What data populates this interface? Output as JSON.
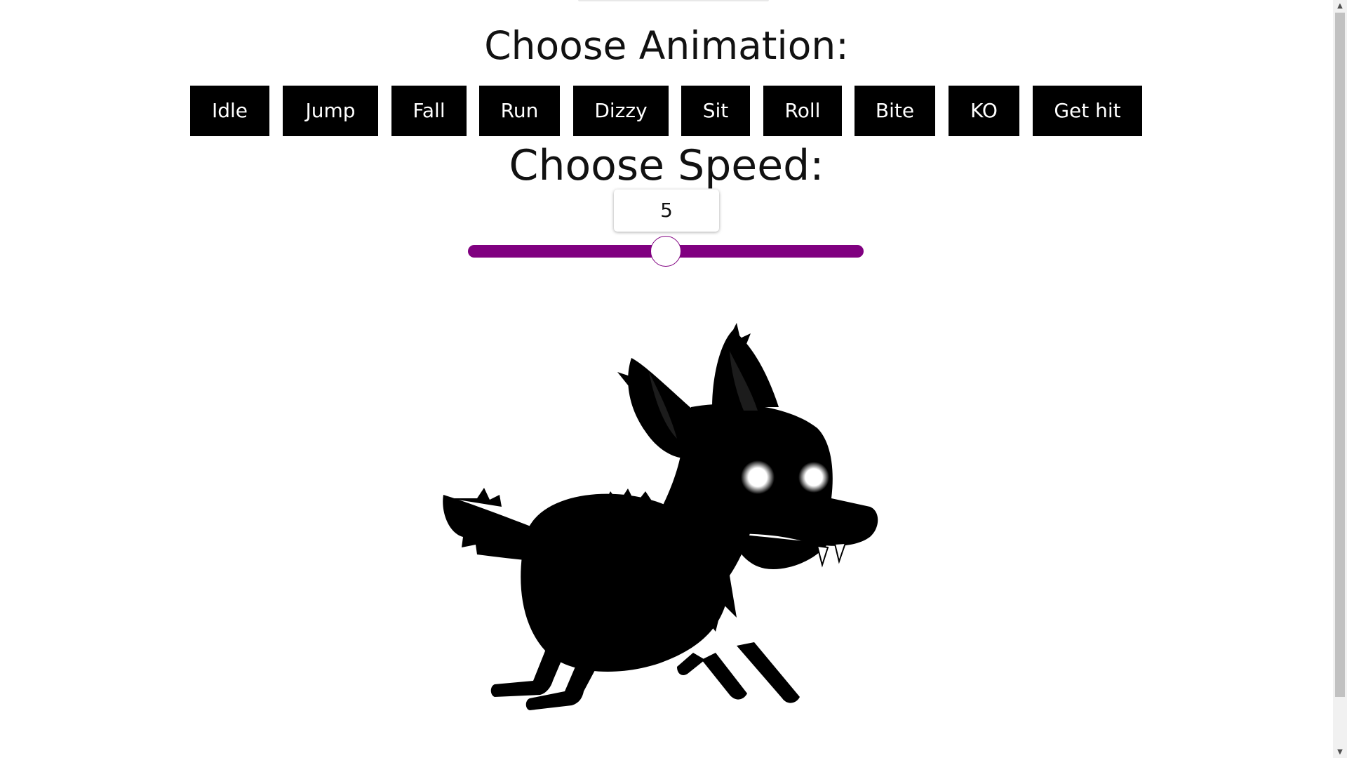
{
  "animation": {
    "heading": "Choose Animation:",
    "buttons": [
      "Idle",
      "Jump",
      "Fall",
      "Run",
      "Dizzy",
      "Sit",
      "Roll",
      "Bite",
      "KO",
      "Get hit"
    ]
  },
  "speed": {
    "heading": "Choose Speed:",
    "value": "5",
    "slider": {
      "min": 1,
      "max": 9,
      "value": 5
    }
  },
  "colors": {
    "button_bg": "#000000",
    "button_text": "#ffffff",
    "slider_track": "#800080",
    "character": "#000000",
    "eyes": "#ffffff"
  },
  "character": {
    "icon": "shadow-wolf-sprite",
    "state": "run"
  }
}
